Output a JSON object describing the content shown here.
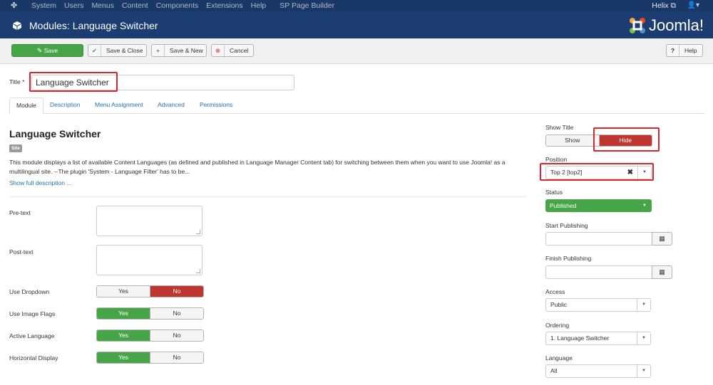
{
  "topbar": {
    "menu": [
      "System",
      "Users",
      "Menus",
      "Content",
      "Components",
      "Extensions",
      "Help",
      "SP Page Builder"
    ],
    "user": "Helix"
  },
  "header": {
    "title": "Modules: Language Switcher",
    "brand": "Joomla!"
  },
  "toolbar": {
    "save": "Save",
    "save_close": "Save & Close",
    "save_new": "Save & New",
    "cancel": "Cancel",
    "help": "Help"
  },
  "form": {
    "title_label": "Title *",
    "title_value": "Language Switcher"
  },
  "tabs": [
    "Module",
    "Description",
    "Menu Assignment",
    "Advanced",
    "Permissions"
  ],
  "module": {
    "name": "Language Switcher",
    "badge": "Site",
    "description": "This module displays a list of available Content Languages (as defined and published in Language Manager Content tab) for switching between them when you want to use Joomla! as a multilingual site. --The plugin 'System - Language Filter' has to be...",
    "show_full": "Show full description ..."
  },
  "fields": {
    "pretext": "Pre-text",
    "posttext": "Post-text",
    "use_dropdown": {
      "label": "Use Dropdown",
      "yes": "Yes",
      "no": "No",
      "selected": "No"
    },
    "use_image_flags": {
      "label": "Use Image Flags",
      "yes": "Yes",
      "no": "No",
      "selected": "Yes"
    },
    "active_language": {
      "label": "Active Language",
      "yes": "Yes",
      "no": "No",
      "selected": "Yes"
    },
    "horizontal_display": {
      "label": "Horizontal Display",
      "yes": "Yes",
      "no": "No",
      "selected": "Yes"
    }
  },
  "sidebar": {
    "show_title": {
      "label": "Show Title",
      "show": "Show",
      "hide": "Hide",
      "selected": "Hide"
    },
    "position": {
      "label": "Position",
      "value": "Top 2 [top2]"
    },
    "status": {
      "label": "Status",
      "value": "Published"
    },
    "start_publishing": {
      "label": "Start Publishing",
      "value": ""
    },
    "finish_publishing": {
      "label": "Finish Publishing",
      "value": ""
    },
    "access": {
      "label": "Access",
      "value": "Public"
    },
    "ordering": {
      "label": "Ordering",
      "value": "1. Language Switcher"
    },
    "language": {
      "label": "Language",
      "value": "All"
    }
  },
  "colors": {
    "header": "#1c3d72",
    "topbar": "#1a3867",
    "success": "#46a546",
    "danger": "#bd362f",
    "highlight": "#d9262c",
    "link": "#2a6fb0"
  }
}
